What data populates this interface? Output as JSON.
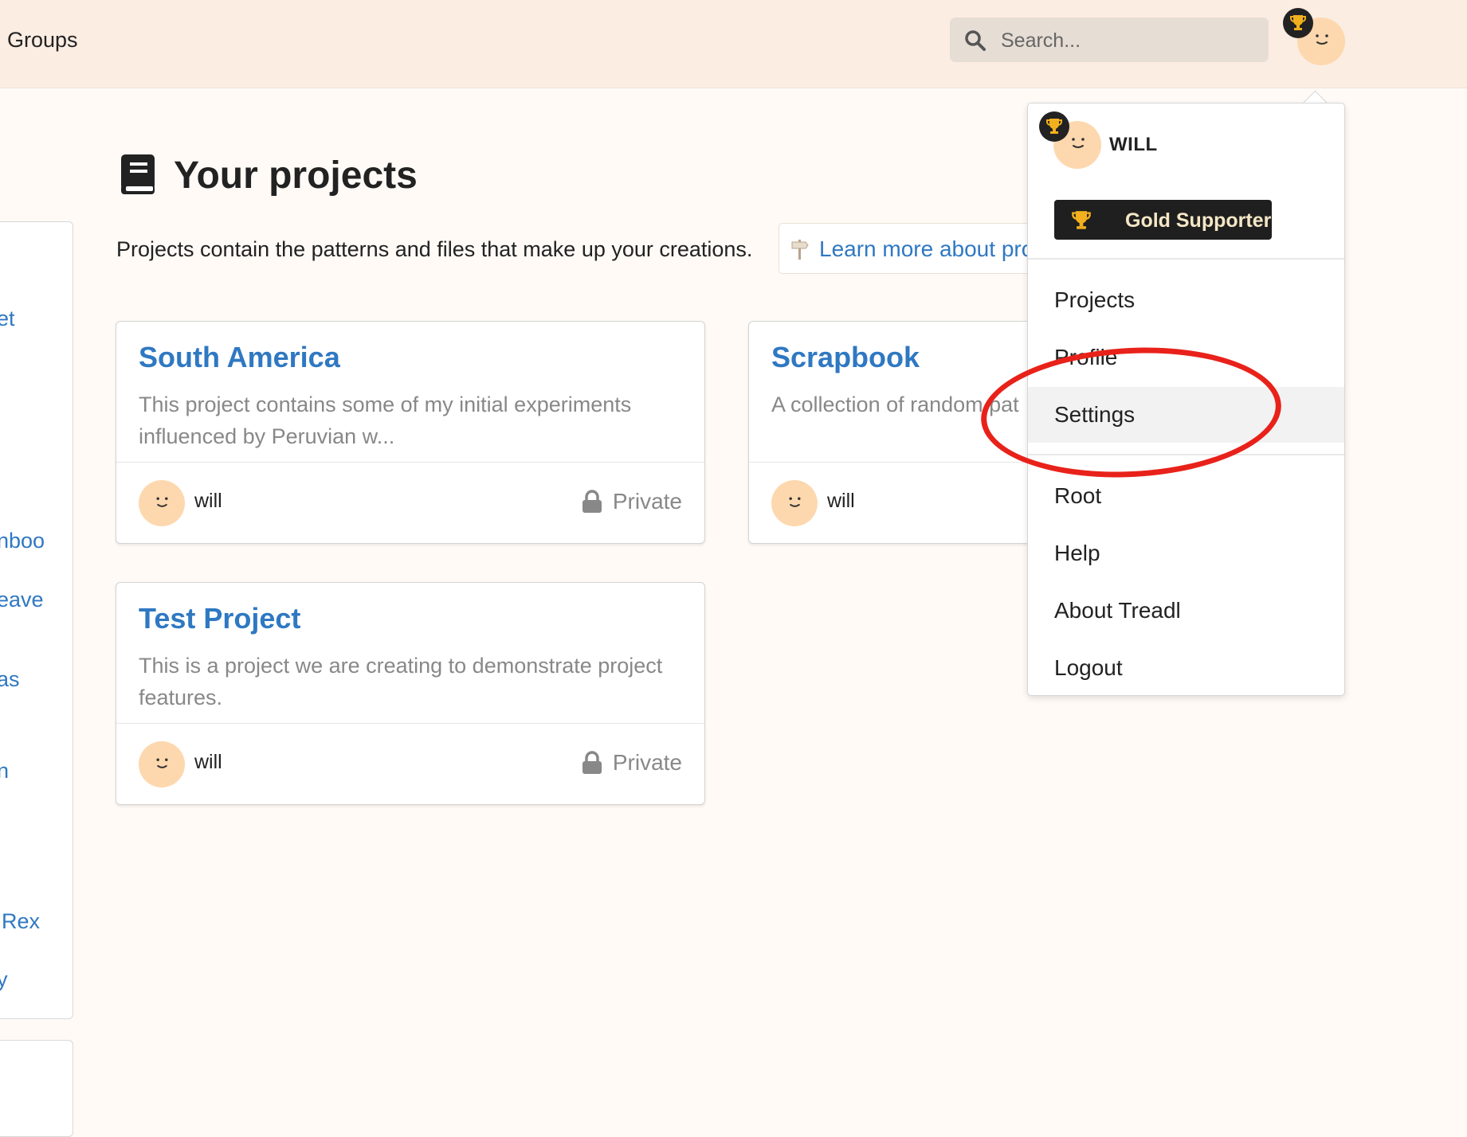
{
  "header": {
    "groups_label": "Groups",
    "search": {
      "placeholder": "Search...",
      "value": ""
    }
  },
  "sidebar": {
    "fragments": [
      "et",
      "nboo",
      "eave",
      "as",
      "n",
      "Rex",
      "y"
    ]
  },
  "main": {
    "title": "Your projects",
    "title_icon": "book-icon",
    "intro": "Projects contain the patterns and files that make up your creations.",
    "learn_more": "Learn more about pro",
    "learn_more_icon": "signpost-icon"
  },
  "projects": [
    {
      "title": "South America",
      "description": "This project contains some of my initial experiments influenced by Peruvian w...",
      "owner": "will",
      "visibility": "Private"
    },
    {
      "title": "Scrapbook",
      "description": "A collection of random pat",
      "owner": "will",
      "visibility": ""
    },
    {
      "title": "Test Project",
      "description": "This is a project we are creating to demonstrate project features.",
      "owner": "will",
      "visibility": "Private"
    }
  ],
  "user_menu": {
    "username": "WILL",
    "badge": "Gold Supporter",
    "items": [
      {
        "label": "Projects"
      },
      {
        "label": "Profile"
      },
      {
        "label": "Settings",
        "highlighted": true
      },
      {
        "label": "Root"
      },
      {
        "label": "Help"
      },
      {
        "label": "About Treadl"
      },
      {
        "label": "Logout"
      }
    ]
  },
  "colors": {
    "header_bg": "#fbede2",
    "page_bg": "#fffaf6",
    "link": "#2f78c2",
    "avatar": "#fdd8ae",
    "trophy": "#f2b01e",
    "annotation": "#e8221a"
  }
}
